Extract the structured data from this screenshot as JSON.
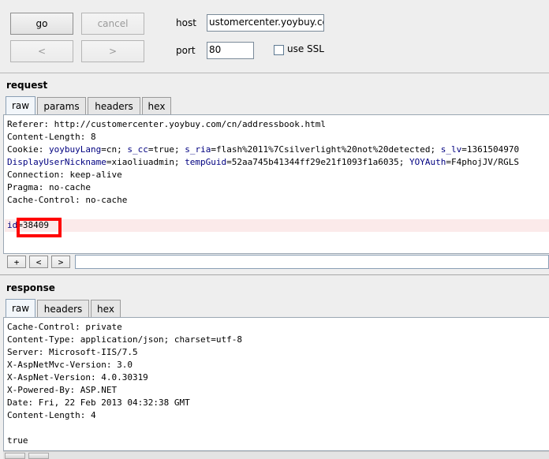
{
  "toolbar": {
    "go_label": "go",
    "cancel_label": "cancel",
    "back_label": "<",
    "forward_label": ">",
    "host_label": "host",
    "host_value": "ustomercenter.yoybuy.com",
    "port_label": "port",
    "port_value": "80",
    "ssl_label": "use SSL"
  },
  "request": {
    "title": "request",
    "tabs": [
      "raw",
      "params",
      "headers",
      "hex"
    ],
    "lines": {
      "referer": "Referer: http://customercenter.yoybuy.com/cn/addressbook.html",
      "content_length": "Content-Length: 8",
      "cookie": {
        "head": "Cookie: ",
        "k1": "yoybuyLang",
        "v1": "=cn; ",
        "k2": "s_cc",
        "v2": "=true; ",
        "k3": "s_ria",
        "v3": "=flash%2011%7Csilverlight%20not%20detected; ",
        "k4": "s_lv",
        "v4": "=1361504970"
      },
      "display": {
        "k1": "DisplayUserNickname",
        "v1": "=xiaoliuadmin; ",
        "k2": "tempGuid",
        "v2": "=52aa745b41344ff29e21f1093f1a6035; ",
        "k3": "YOYAuth",
        "v3": "=F4phojJV/RGLS"
      },
      "connection": "Connection: keep-alive",
      "pragma": "Pragma: no-cache",
      "cache_control": "Cache-Control: no-cache",
      "body_key": "id",
      "body_eq": "=",
      "body_value": "38409"
    },
    "nav_buttons": [
      "+",
      "<",
      ">"
    ]
  },
  "response": {
    "title": "response",
    "tabs": [
      "raw",
      "headers",
      "hex"
    ],
    "lines": [
      "Cache-Control: private",
      "Content-Type: application/json; charset=utf-8",
      "Server: Microsoft-IIS/7.5",
      "X-AspNetMvc-Version: 3.0",
      "X-AspNet-Version: 4.0.30319",
      "X-Powered-By: ASP.NET",
      "Date: Fri, 22 Feb 2013 04:32:38 GMT",
      "Content-Length: 4",
      "",
      "true"
    ]
  },
  "colors": {
    "highlight_box": "#ff0000",
    "param_key": "#000080",
    "background": "#eeeeee"
  }
}
